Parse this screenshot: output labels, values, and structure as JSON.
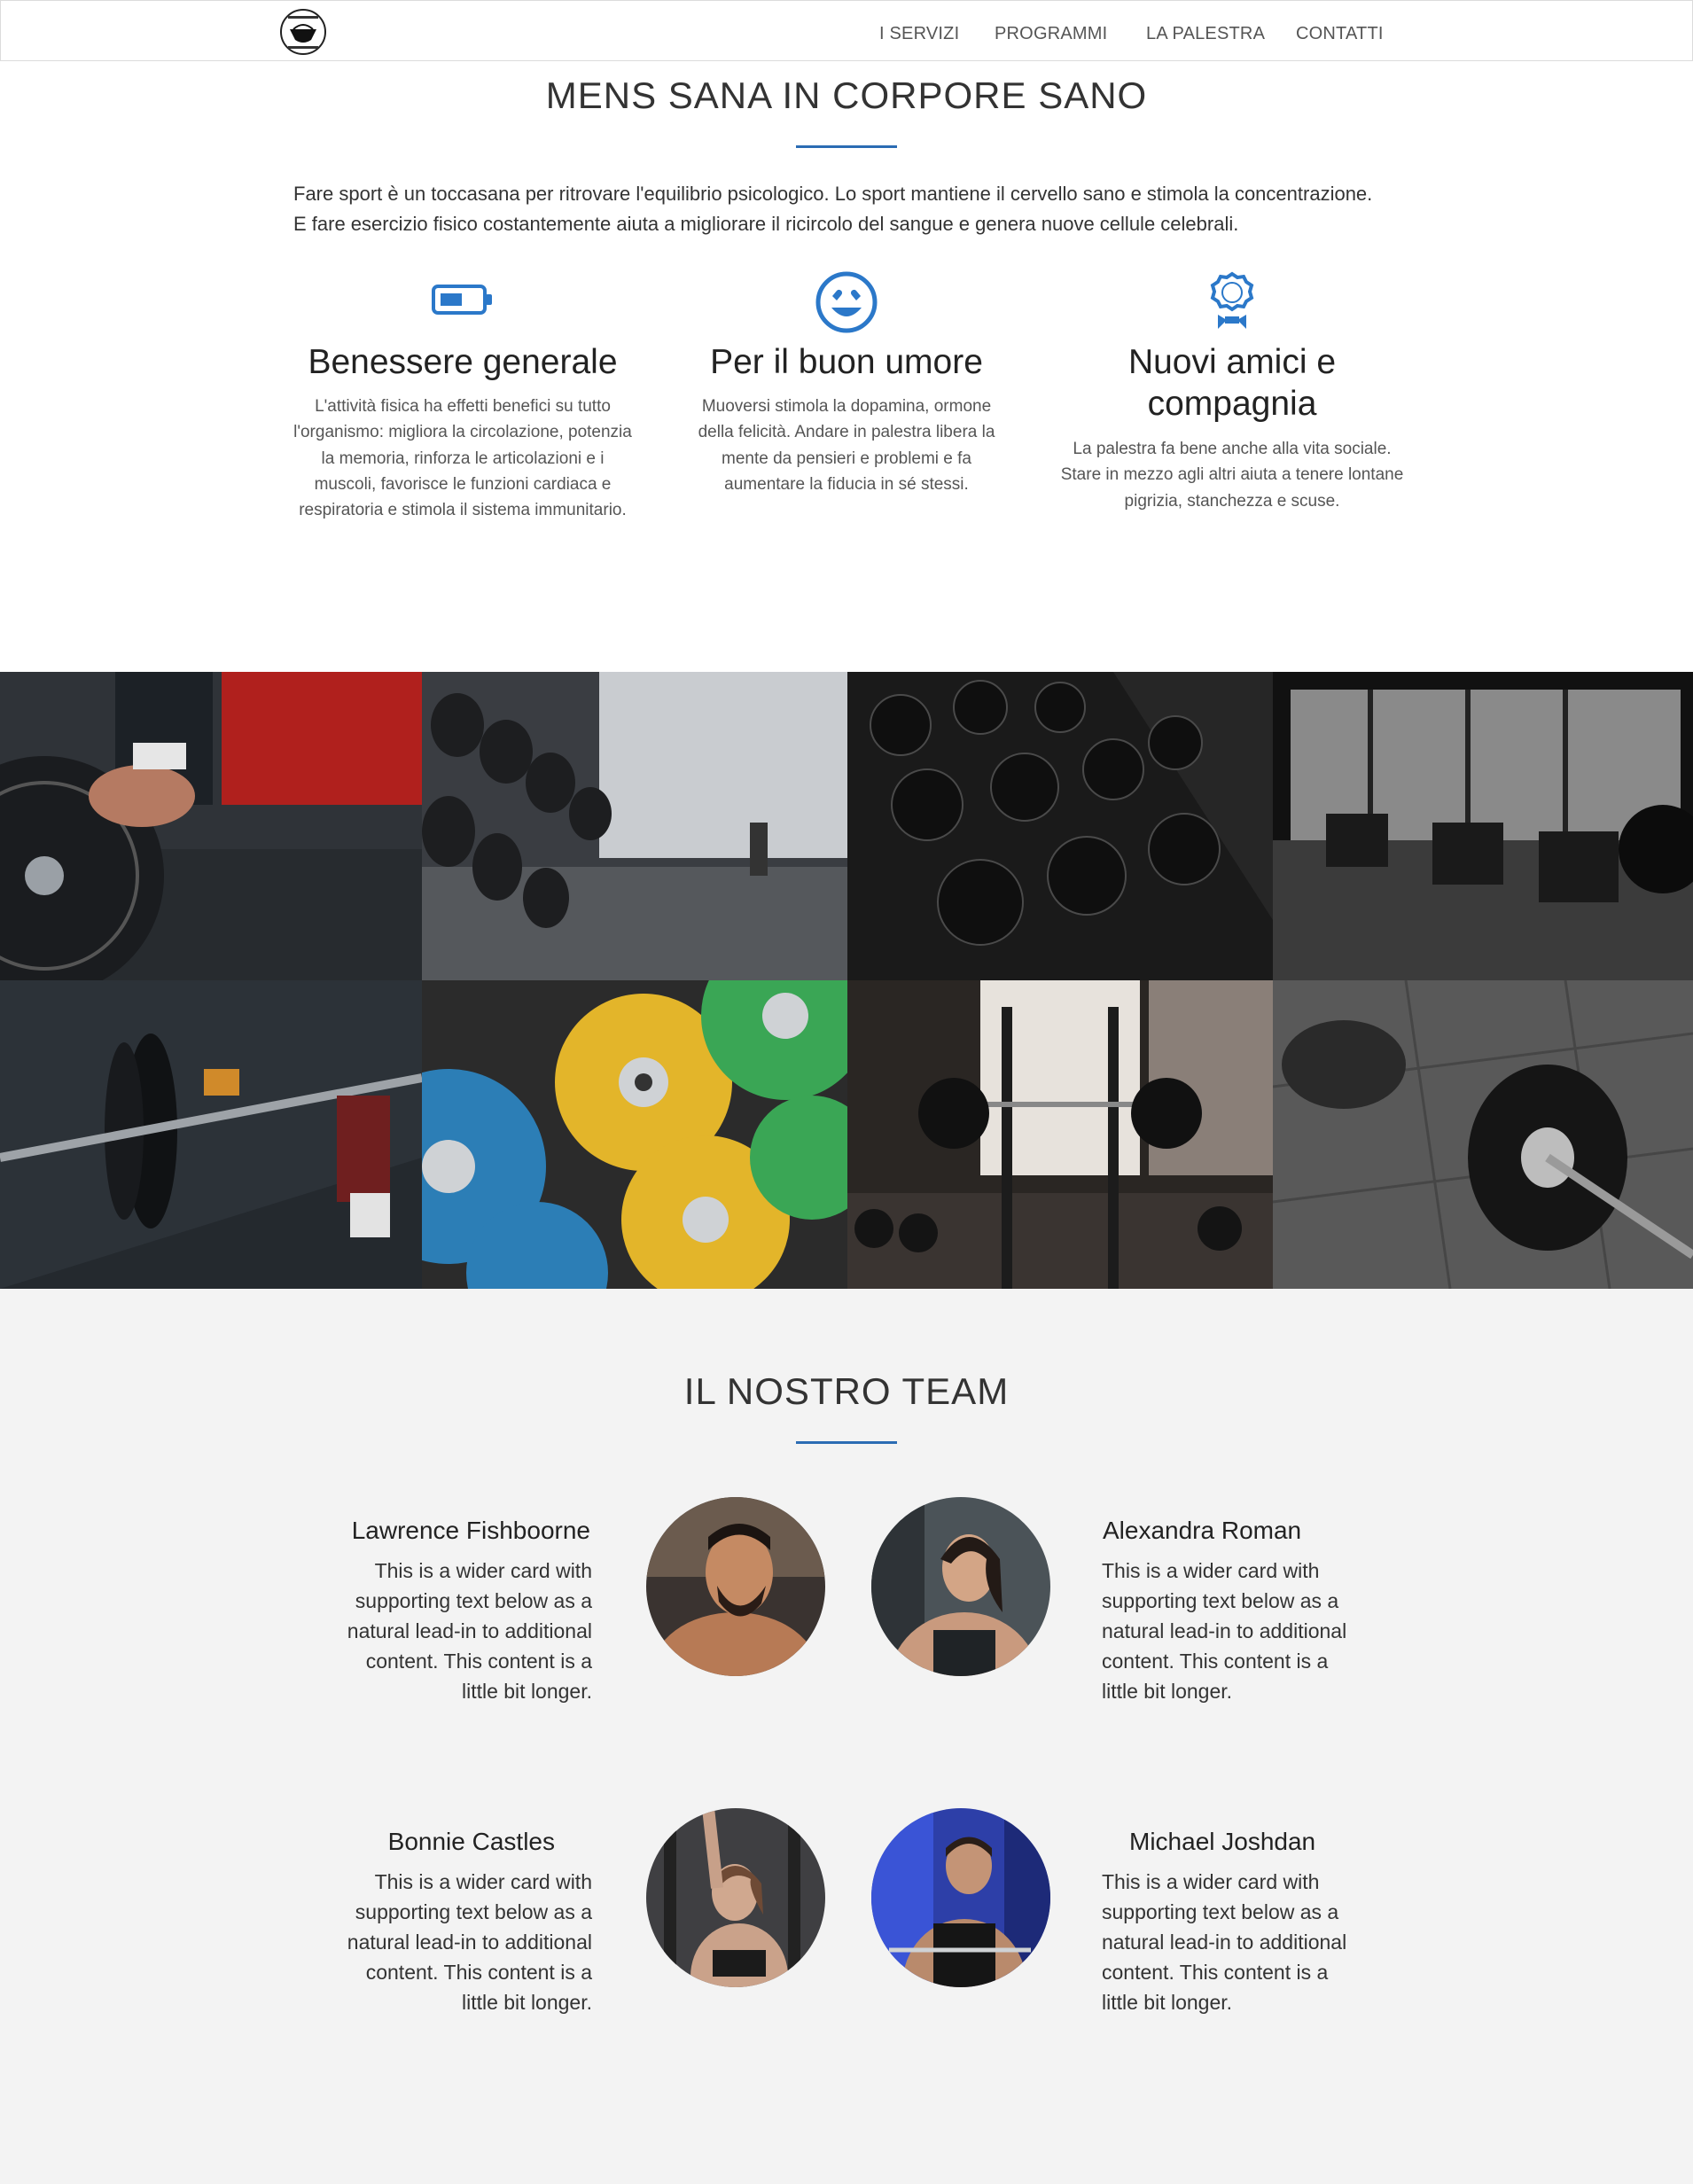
{
  "nav": {
    "logo_icon": "gym-logo-icon",
    "items": [
      {
        "label": "I SERVIZI"
      },
      {
        "label": "PROGRAMMI"
      },
      {
        "label": "LA PALESTRA"
      },
      {
        "label": "CONTATTI"
      }
    ]
  },
  "about": {
    "title": "MENS SANA IN CORPORE SANO",
    "intro": [
      "Fare sport è un toccasana per ritrovare l'equilibrio psicologico. Lo sport mantiene il cervello sano e stimola la concentrazione.",
      "E fare esercizio fisico costantemente aiuta a migliorare il ricircolo del sangue e genera nuove cellule celebrali."
    ],
    "features": [
      {
        "icon": "battery-icon",
        "title": "Benessere generale",
        "text": "L'attività fisica ha effetti benefici su tutto l'organismo: migliora la circolazione, potenzia la memoria, rinforza le articolazioni e i muscoli, favorisce le funzioni cardiaca e respiratoria e stimola il sistema immunitario."
      },
      {
        "icon": "smiley-heart-eyes-icon",
        "title": "Per il buon umore",
        "text": "Muoversi stimola la dopamina, ormone della felicità. Andare in palestra libera la mente da pensieri e problemi e fa aumentare la fiducia in sé stessi."
      },
      {
        "icon": "award-ribbon-icon",
        "title": "Nuovi amici e compagnia",
        "text": "La palestra fa bene anche alla vita sociale. Stare in mezzo agli altri aiuta a tenere lontane pigrizia, stanchezza e scuse."
      }
    ],
    "accent_color": "#2b6cb3"
  },
  "gallery": {
    "images": [
      "barbell-plate-photo",
      "dumbbell-rack-photo",
      "dumbbells-dark-photo",
      "gym-interior-bw-photo",
      "deadlift-photo",
      "rogue-plates-photo",
      "squat-rack-photo",
      "barbell-floor-bw-photo"
    ]
  },
  "team": {
    "title": "IL NOSTRO TEAM",
    "members": [
      {
        "name": "Lawrence Fishboorne",
        "text": [
          "This is a wider card with",
          "supporting text below as a",
          "natural lead-in to additional",
          "content. This content is a",
          "little bit longer."
        ]
      },
      {
        "name": "Alexandra Roman",
        "text": [
          "This is a wider card with",
          "supporting text below as a",
          "natural lead-in to additional",
          "content. This content is a",
          "little bit longer."
        ]
      },
      {
        "name": "Bonnie Castles",
        "text": [
          "This is a wider card with",
          "supporting text below as a",
          "natural lead-in to additional",
          "content. This content is a",
          "little bit longer."
        ]
      },
      {
        "name": "Michael Joshdan",
        "text": [
          "This is a wider card with",
          "supporting text below as a",
          "natural lead-in to additional",
          "content. This content is a",
          "little bit longer."
        ]
      }
    ]
  }
}
